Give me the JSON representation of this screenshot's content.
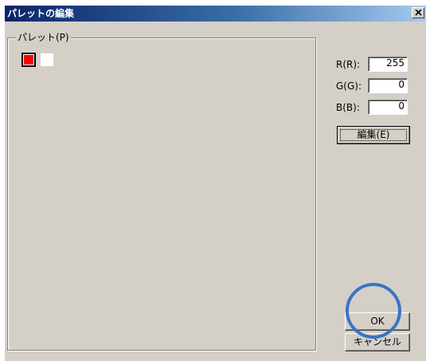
{
  "window": {
    "title": "パレットの編集"
  },
  "palette_group": {
    "label": "パレット(P)"
  },
  "palette_swatches": [
    {
      "color": "#ff0000",
      "selected": true
    },
    {
      "color": "#ffffff",
      "selected": false
    }
  ],
  "fields": {
    "r": {
      "label": "R(R):",
      "value": "255"
    },
    "g": {
      "label": "G(G):",
      "value": "0"
    },
    "b": {
      "label": "B(B):",
      "value": "0"
    }
  },
  "buttons": {
    "edit": "編集(E)",
    "ok": "OK",
    "cancel": "キャンセル"
  },
  "colors": {
    "highlight_circle": "#3b74c4"
  }
}
